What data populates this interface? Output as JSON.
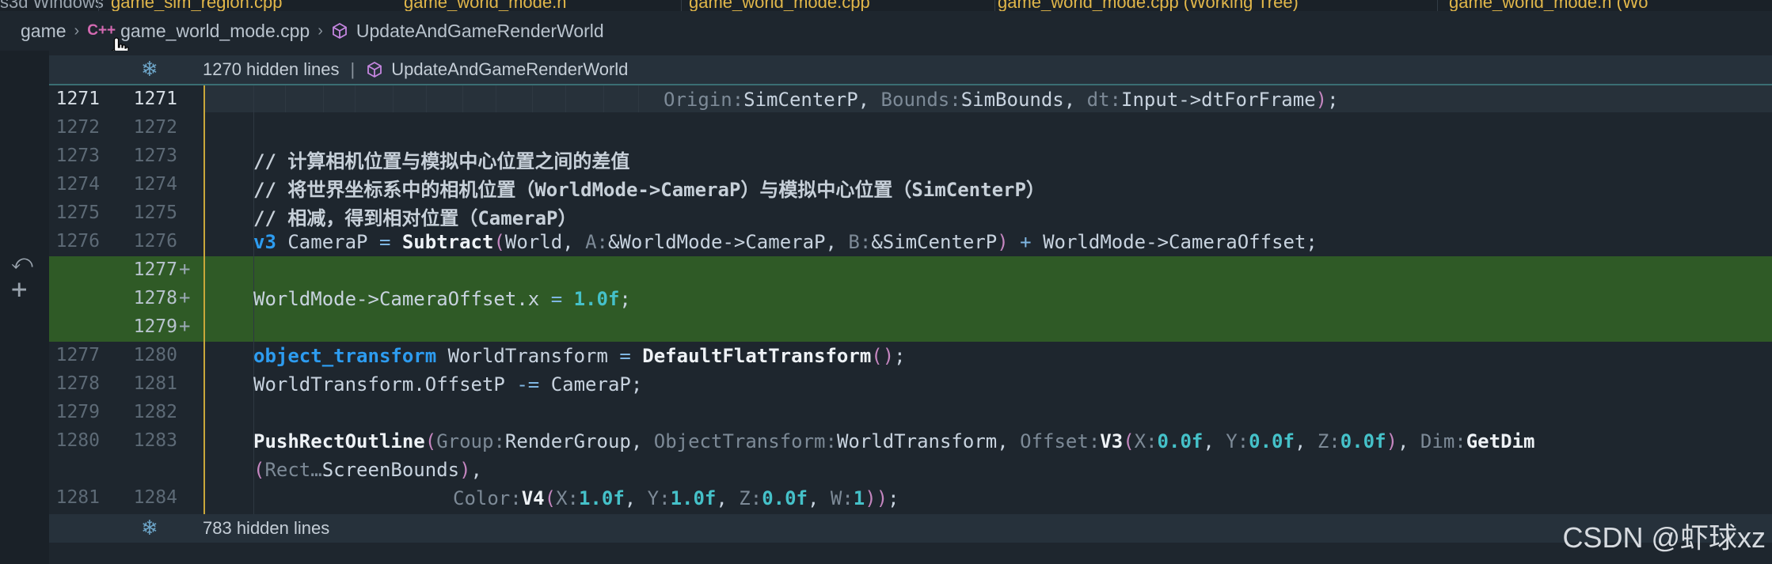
{
  "tabs": [
    {
      "label": "s3d Windows"
    },
    {
      "label": "game_sim_region.cpp"
    },
    {
      "label": "game_world_mode.h"
    },
    {
      "label": "game_world_mode.cpp"
    },
    {
      "label": "game_world_mode.cpp (Working Tree)"
    },
    {
      "label": "game_world_mode.h (Wo"
    }
  ],
  "breadcrumb": {
    "root": "game",
    "file_icon_text": "C++",
    "file": "game_world_mode.cpp",
    "symbol": "UpdateAndGameRenderWorld"
  },
  "folds": {
    "top_label": "1270 hidden lines",
    "top_separator": "|",
    "top_symbol": "UpdateAndGameRenderWorld",
    "bottom_label": "783 hidden lines"
  },
  "watermark": "CSDN @虾球xz",
  "colors": {
    "added_bg": "#2f5a26",
    "accent_bar": "#c8a63a",
    "keyword": "#2d9cf0",
    "number": "#45c1c9"
  },
  "lines": [
    {
      "left": "1271",
      "right": "1271",
      "current": true
    },
    {
      "left": "1272",
      "right": "1272"
    },
    {
      "left": "1273",
      "right": "1273"
    },
    {
      "left": "1274",
      "right": "1274"
    },
    {
      "left": "1275",
      "right": "1275"
    },
    {
      "left": "1276",
      "right": "1276"
    },
    {
      "left": "",
      "right": "1277",
      "added": true
    },
    {
      "left": "",
      "right": "1278",
      "added": true
    },
    {
      "left": "",
      "right": "1279",
      "added": true
    },
    {
      "left": "1277",
      "right": "1280"
    },
    {
      "left": "1278",
      "right": "1281"
    },
    {
      "left": "1279",
      "right": "1282"
    },
    {
      "left": "1280",
      "right": "1283"
    },
    {
      "left": "",
      "right": ""
    },
    {
      "left": "1281",
      "right": "1284"
    }
  ],
  "code": {
    "l1_h1": "Origin:",
    "l1_v1": "SimCenterP, ",
    "l1_h2": "Bounds:",
    "l1_v2": "SimBounds, ",
    "l1_h3": "dt:",
    "l1_v3": "Input->dtForFrame",
    "l1_close": ")",
    "l1_semi": ";",
    "c1": "// 计算相机位置与模拟中心位置之间的差值",
    "c2": "// 将世界坐标系中的相机位置（WorldMode->CameraP）与模拟中心位置（SimCenterP）",
    "c3": "// 相减，得到相对位置（CameraP）",
    "l6_type": "v3",
    "l6_a": " CameraP ",
    "l6_eq": "=",
    "l6_fn": " Subtract",
    "l6_open": "(",
    "l6_b": "World, ",
    "l6_hA": "A:",
    "l6_c": "&WorldMode->CameraP, ",
    "l6_hB": "B:",
    "l6_d": "&SimCenterP",
    "l6_close": ")",
    "l6_plus": " + ",
    "l6_e": "WorldMode->CameraOffset;",
    "add_a": "WorldMode->CameraOffset.x ",
    "add_eq": "=",
    "add_num": " 1.0f",
    "add_semi": ";",
    "l10_type": "object_transform",
    "l10_a": " WorldTransform ",
    "l10_eq": "=",
    "l10_fn": " DefaultFlatTransform",
    "l10_par": "()",
    "l10_semi": ";",
    "l11_a": "WorldTransform.OffsetP ",
    "l11_op": "-=",
    "l11_b": " CameraP;",
    "l13_fn": "PushRectOutline",
    "l13_open": "(",
    "l13_h1": "Group:",
    "l13_v1": "RenderGroup, ",
    "l13_h2": "ObjectTransform:",
    "l13_v2": "WorldTransform, ",
    "l13_h3": "Offset:",
    "l13_fn2": "V3",
    "l13_open2": "(",
    "l13_h4": "X:",
    "l13_n1": "0.0f",
    "l13_c1": ", ",
    "l13_h5": "Y:",
    "l13_n2": "0.0f",
    "l13_c2": ", ",
    "l13_h6": "Z:",
    "l13_n3": "0.0f",
    "l13_close2": ")",
    "l13_c3": ", ",
    "l13_h7": "Dim:",
    "l13_fn3": "GetDim",
    "l14_open": "(",
    "l14_h": "Rect…",
    "l14_v": "ScreenBounds",
    "l14_close": ")",
    "l14_comma": ",",
    "l15_h1": "Color:",
    "l15_fn": "V4",
    "l15_open": "(",
    "l15_hx": "X:",
    "l15_nx": "1.0f",
    "l15_c1": ", ",
    "l15_hy": "Y:",
    "l15_ny": "1.0f",
    "l15_c2": ", ",
    "l15_hz": "Z:",
    "l15_nz": "0.0f",
    "l15_c3": ", ",
    "l15_hw": "W:",
    "l15_nw": "1",
    "l15_close": "))",
    "l15_semi": ";"
  }
}
